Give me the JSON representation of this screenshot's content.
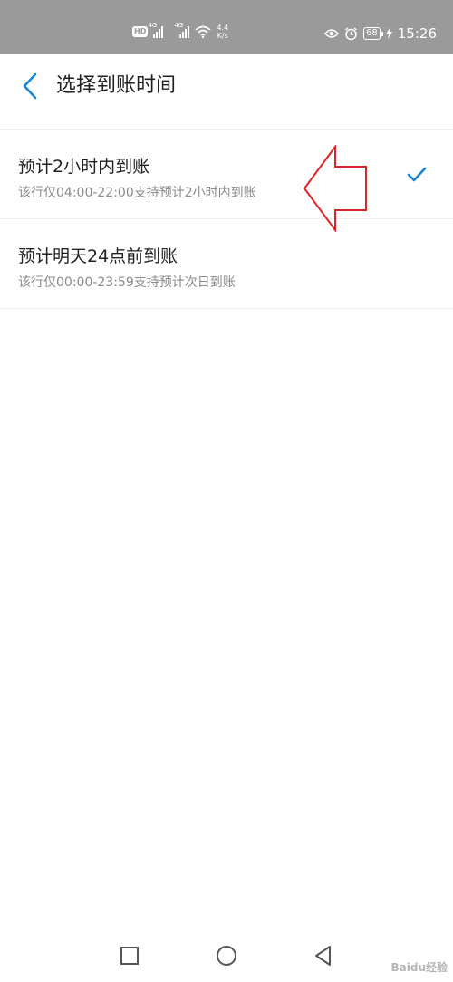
{
  "status_bar": {
    "hd_label": "HD",
    "network_1": "4G",
    "network_2": "4G",
    "speed_value": "4.4",
    "speed_unit": "K/s",
    "battery": "68",
    "time": "15:26",
    "icons": [
      "hd-icon",
      "signal-icon",
      "signal-icon",
      "wifi-icon",
      "eye-icon",
      "alarm-icon",
      "battery-icon",
      "charging-icon"
    ]
  },
  "header": {
    "title": "选择到账时间",
    "back_icon": "chevron-left-icon"
  },
  "options": [
    {
      "title": "预计2小时内到账",
      "subtitle": "该行仅04:00-22:00支持预计2小时内到账",
      "selected": true
    },
    {
      "title": "预计明天24点前到账",
      "subtitle": "该行仅00:00-23:59支持预计次日到账",
      "selected": false
    }
  ],
  "colors": {
    "accent": "#1a86d8",
    "status_bar": "#9a9a9a",
    "annotation_arrow": "#d9262b"
  },
  "nav_bar": {
    "icons": [
      "square-icon",
      "circle-icon",
      "triangle-back-icon"
    ]
  },
  "watermark": "Baidu经验"
}
